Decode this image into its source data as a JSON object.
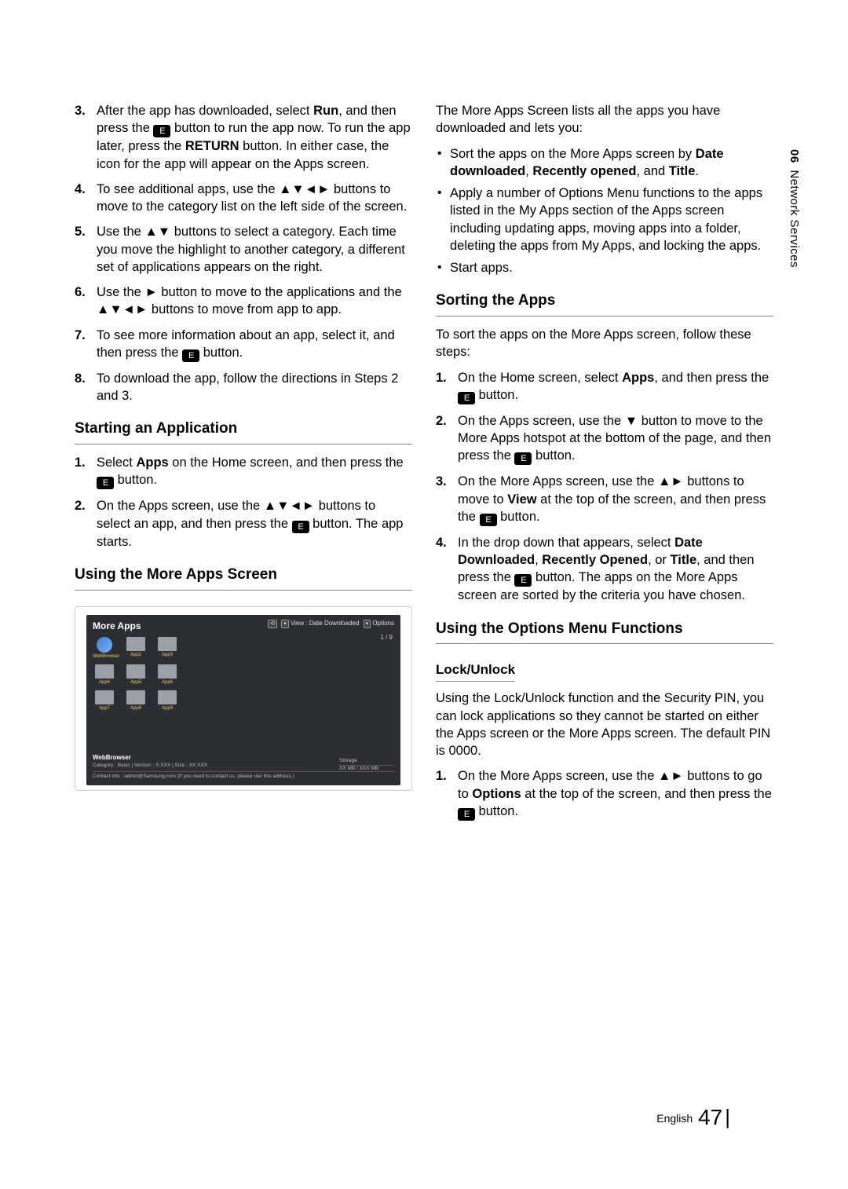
{
  "sideTab": {
    "chapter": "06",
    "title": "Network Services"
  },
  "footer": {
    "lang": "English",
    "page": "47"
  },
  "col1": {
    "steps": [
      {
        "n": "3.",
        "pre": "After the app has downloaded, select ",
        "b1": "Run",
        "mid1": ", and then press the ",
        "icon": true,
        "mid2": " button to run the app now. To run the app later, press the ",
        "b2": "RETURN",
        "post": " button. In either case, the icon for the app will appear on the Apps screen."
      },
      {
        "n": "4.",
        "text": "To see additional apps, use the ▲▼◄► buttons to move to the category list on the left side of the screen."
      },
      {
        "n": "5.",
        "text": "Use the ▲▼ buttons to select a category. Each time you move the highlight to another category, a different set of applications appears on the right."
      },
      {
        "n": "6.",
        "text": "Use the ► button to move to the applications and the ▲▼◄► buttons to move from app to app."
      },
      {
        "n": "7.",
        "pre": "To see more information about an app, select it, and then press the ",
        "icon": true,
        "post": " button."
      },
      {
        "n": "8.",
        "text": "To download the app, follow the directions in Steps 2 and 3."
      }
    ],
    "h_start": "Starting an Application",
    "start_steps": [
      {
        "n": "1.",
        "pre": "Select ",
        "b1": "Apps",
        "mid1": " on the Home screen, and then press the ",
        "icon": true,
        "post": " button."
      },
      {
        "n": "2.",
        "pre": "On the Apps screen, use the ▲▼◄► buttons to select an app, and then press the ",
        "icon": true,
        "post": " button. The app starts."
      }
    ],
    "h_more": "Using the More Apps Screen"
  },
  "figure": {
    "title": "More Apps",
    "viewLabel": "View : Date Downloaded",
    "optionsLabel": "Options",
    "pager": "1 / 9",
    "apps": [
      "WebBrowser",
      "App2",
      "App3",
      "App4",
      "App5",
      "App6",
      "App7",
      "App8",
      "App9"
    ],
    "detailName": "WebBrowser",
    "detailLine": "Category : Basic  |  Version : X.XXX  |  Size : XX.XXX",
    "contact": "Contact info : admin@Samsung.com (If you need to contact us, please use this address.)",
    "storageLabel": "Storage",
    "storageValue": "XX MB / XXX  MB"
  },
  "col2": {
    "intro": "The More Apps Screen lists all the apps you have downloaded and lets you:",
    "bullets_intro": [
      {
        "pre": "Sort the apps on the More Apps screen by ",
        "b1": "Date downloaded",
        "sep1": ", ",
        "b2": "Recently opened",
        "sep2": ", and ",
        "b3": "Title",
        "post": "."
      },
      {
        "text": "Apply a number of Options Menu functions to the apps listed in the My Apps section of the Apps screen including updating apps, moving apps into a folder, deleting the apps from My Apps, and locking the apps."
      },
      {
        "text": "Start apps."
      }
    ],
    "h_sort": "Sorting the Apps",
    "sort_intro": "To sort the apps on the More Apps screen, follow these steps:",
    "sort_steps": [
      {
        "n": "1.",
        "pre": "On the Home screen, select ",
        "b1": "Apps",
        "mid1": ", and then press the ",
        "icon": true,
        "post": " button."
      },
      {
        "n": "2.",
        "pre": "On the Apps screen, use the ▼ button to move to the More Apps hotspot at the bottom of the page, and then press the ",
        "icon": true,
        "post": " button."
      },
      {
        "n": "3.",
        "pre": "On the More Apps screen, use the ▲► buttons to move to ",
        "b1": "View",
        "mid1": " at the top of the screen, and then press the ",
        "icon": true,
        "post": " button."
      },
      {
        "n": "4.",
        "pre": "In the drop down that appears, select ",
        "b1": "Date Downloaded",
        "sep1": ", ",
        "b2": "Recently Opened",
        "sep2": ", or ",
        "b3": "Title",
        "mid1": ", and then press the ",
        "icon": true,
        "post": " button. The apps on the More Apps screen are sorted by the criteria you have chosen."
      }
    ],
    "h_options": "Using the Options Menu Functions",
    "h_lock": "Lock/Unlock",
    "lock_para": "Using the Lock/Unlock function and the Security PIN, you can lock applications so they cannot be started on either the Apps screen or the More Apps screen. The default PIN is 0000.",
    "lock_steps": [
      {
        "n": "1.",
        "pre": "On the More Apps screen, use the ▲► buttons to go to ",
        "b1": "Options",
        "mid1": " at the top of the screen, and then press the ",
        "icon": true,
        "post": " button."
      }
    ]
  }
}
